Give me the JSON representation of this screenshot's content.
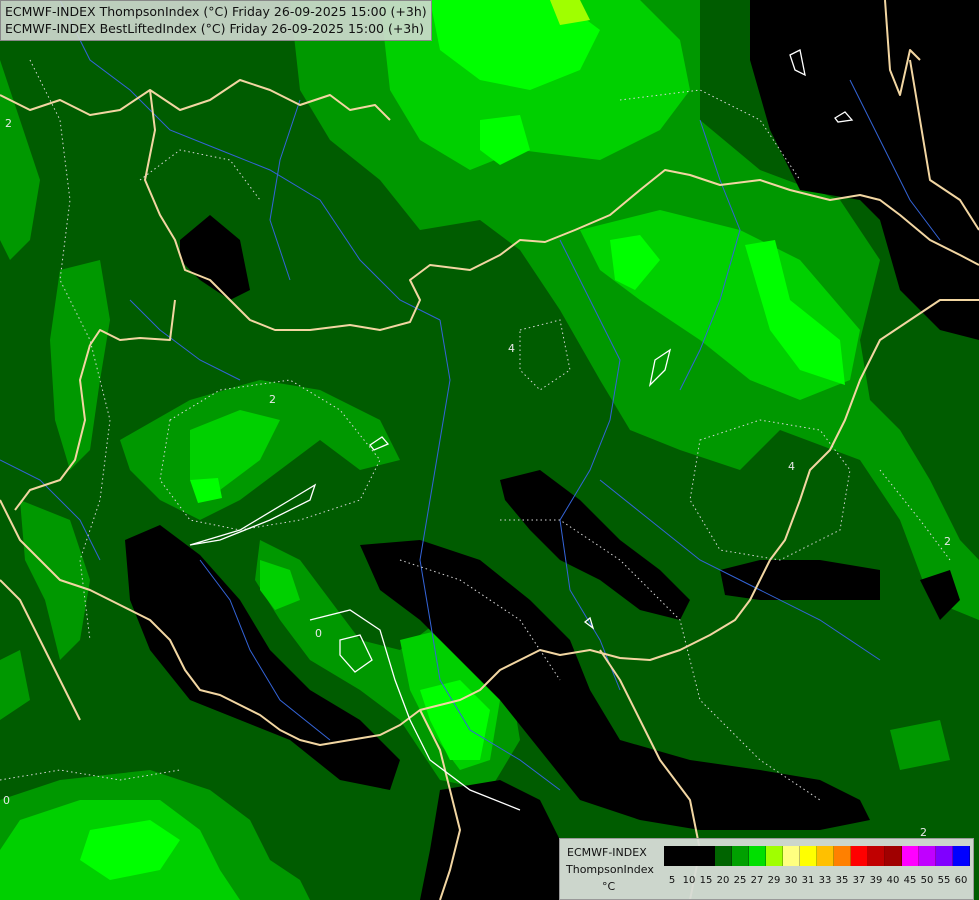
{
  "title": {
    "line1": "ECMWF-INDEX ThompsonIndex (°C) Friday 26-09-2025 15:00 (+3h)",
    "line2": "ECMWF-INDEX BestLiftedIndex (°C) Friday 26-09-2025 15:00 (+3h)"
  },
  "legend": {
    "model": "ECMWF-INDEX",
    "param": "ThompsonIndex",
    "unit": "°C",
    "stops": [
      {
        "label": "5",
        "color": "#000000"
      },
      {
        "label": "10",
        "color": "#000000"
      },
      {
        "label": "15",
        "color": "#000000"
      },
      {
        "label": "20",
        "color": "#006400"
      },
      {
        "label": "25",
        "color": "#00a000"
      },
      {
        "label": "27",
        "color": "#00e000"
      },
      {
        "label": "29",
        "color": "#a0ff00"
      },
      {
        "label": "30",
        "color": "#ffff80"
      },
      {
        "label": "31",
        "color": "#ffff00"
      },
      {
        "label": "33",
        "color": "#ffc000"
      },
      {
        "label": "35",
        "color": "#ff8000"
      },
      {
        "label": "37",
        "color": "#ff0000"
      },
      {
        "label": "39",
        "color": "#c00000"
      },
      {
        "label": "40",
        "color": "#a00000"
      },
      {
        "label": "45",
        "color": "#ff00ff"
      },
      {
        "label": "50",
        "color": "#c000ff"
      },
      {
        "label": "55",
        "color": "#8000ff"
      },
      {
        "label": "60",
        "color": "#0000ff"
      }
    ]
  },
  "map": {
    "contour_labels": [
      "2",
      "2",
      "4",
      "4",
      "2",
      "0",
      "0",
      "2"
    ],
    "colors": {
      "background": "#005a00",
      "mid_green": "#009a00",
      "light_green": "#00d800",
      "bright_green": "#00ff00",
      "black": "#000000",
      "border": "#f5d8a8",
      "river": "#3060d0"
    }
  }
}
